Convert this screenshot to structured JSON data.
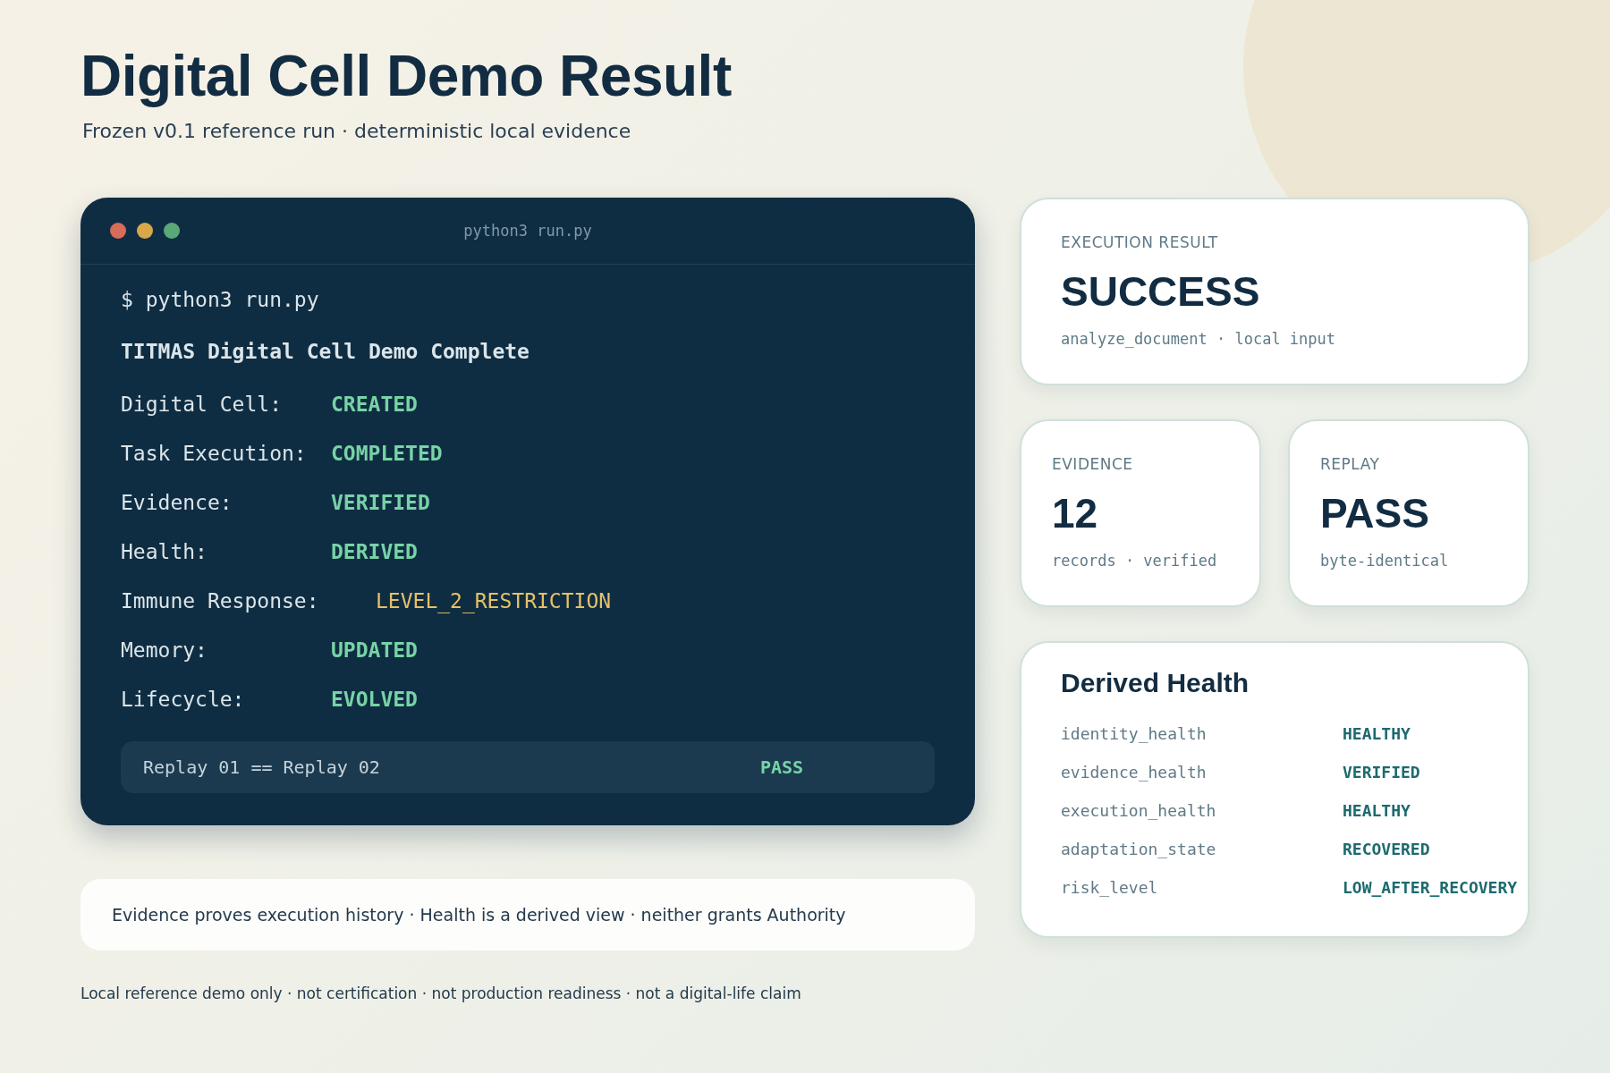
{
  "header": {
    "title": "Digital Cell Demo Result",
    "subtitle": "Frozen v0.1 reference run · deterministic local evidence"
  },
  "terminal": {
    "title": "python3 run.py",
    "command": "$ python3 run.py",
    "heading": "TITMAS Digital Cell Demo Complete",
    "rows": [
      {
        "label": "Digital Cell:",
        "value": "CREATED",
        "kind": "ok"
      },
      {
        "label": "Task Execution:",
        "value": "COMPLETED",
        "kind": "ok"
      },
      {
        "label": "Evidence:",
        "value": "VERIFIED",
        "kind": "ok"
      },
      {
        "label": "Health:",
        "value": "DERIVED",
        "kind": "ok"
      },
      {
        "label": "Immune Response:",
        "value": "LEVEL_2_RESTRICTION",
        "kind": "warn"
      },
      {
        "label": "Memory:",
        "value": "UPDATED",
        "kind": "ok"
      },
      {
        "label": "Lifecycle:",
        "value": "EVOLVED",
        "kind": "ok"
      }
    ],
    "replay": {
      "label": "Replay 01 == Replay 02",
      "result": "PASS"
    }
  },
  "execution_result": {
    "label": "EXECUTION RESULT",
    "value": "SUCCESS",
    "detail": "analyze_document · local input"
  },
  "stats": [
    {
      "label": "EVIDENCE",
      "value": "12",
      "detail": "records · verified"
    },
    {
      "label": "REPLAY",
      "value": "PASS",
      "detail": "byte-identical"
    }
  ],
  "derived_health": {
    "title": "Derived Health",
    "rows": [
      {
        "key": "identity_health",
        "value": "HEALTHY"
      },
      {
        "key": "evidence_health",
        "value": "VERIFIED"
      },
      {
        "key": "execution_health",
        "value": "HEALTHY"
      },
      {
        "key": "adaptation_state",
        "value": "RECOVERED"
      },
      {
        "key": "risk_level",
        "value": "LOW_AFTER_RECOVERY"
      }
    ]
  },
  "note": "Evidence proves execution history · Health is a derived view · neither grants Authority",
  "footer": "Local reference demo only · not certification · not production readiness · not a digital-life claim"
}
